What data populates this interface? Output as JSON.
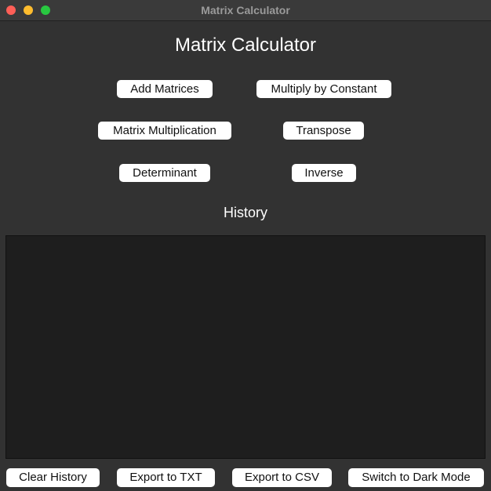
{
  "window": {
    "title": "Matrix Calculator",
    "controls": {
      "close_color": "#ff5f57",
      "minimize_color": "#febc2e",
      "zoom_color": "#28c840"
    }
  },
  "app": {
    "title": "Matrix Calculator"
  },
  "operations": {
    "add_matrices": "Add Matrices",
    "multiply_by_constant": "Multiply by Constant",
    "matrix_multiplication": "Matrix Multiplication",
    "transpose": "Transpose",
    "determinant": "Determinant",
    "inverse": "Inverse"
  },
  "history": {
    "heading": "History",
    "entries": []
  },
  "footer": {
    "clear_history": "Clear History",
    "export_txt": "Export to TXT",
    "export_csv": "Export to CSV",
    "switch_theme": "Switch to Dark Mode"
  },
  "colors": {
    "window_bg": "#323232",
    "history_bg": "#1e1e1e",
    "button_bg": "#ffffff",
    "text_light": "#ffffff"
  }
}
